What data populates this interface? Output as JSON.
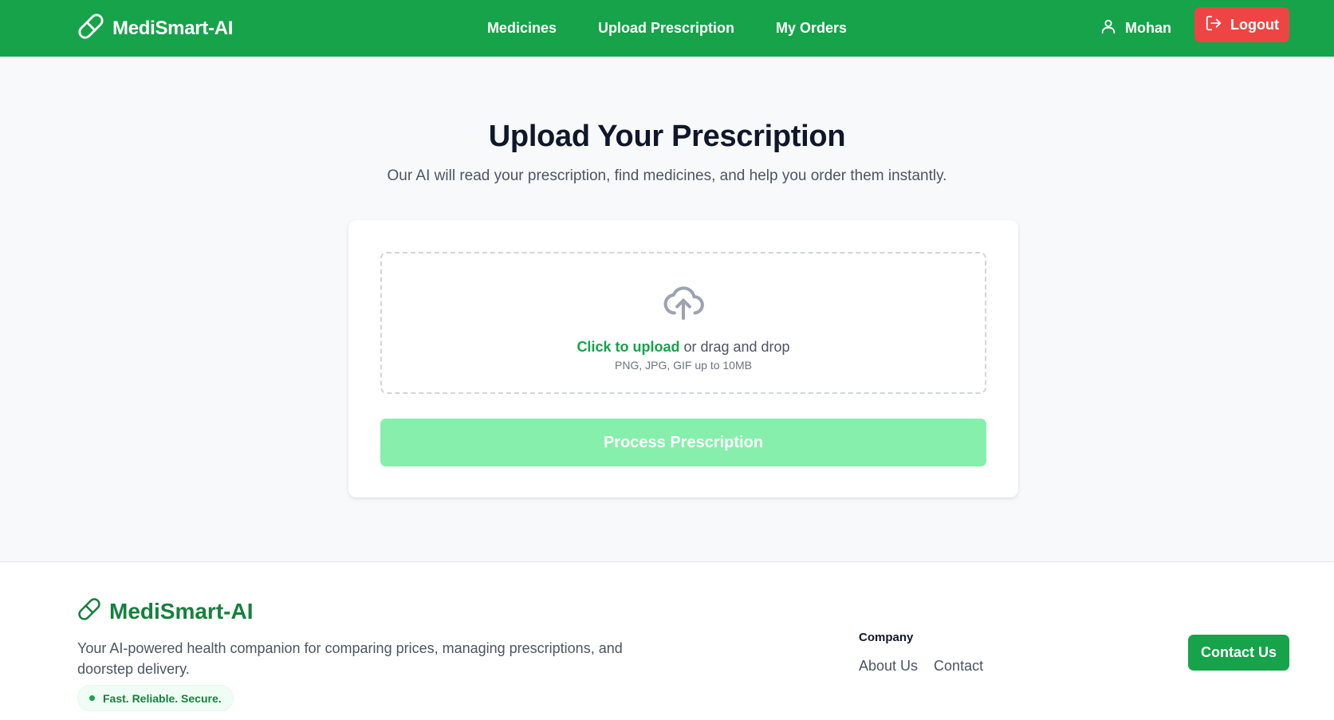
{
  "header": {
    "brand": "MediSmart-AI",
    "brand_icon": "pill-icon",
    "nav": [
      {
        "label": "Medicines"
      },
      {
        "label": "Upload Prescription"
      },
      {
        "label": "My Orders"
      }
    ],
    "user": {
      "name": "Mohan",
      "icon": "user-icon"
    },
    "logout": {
      "label": "Logout",
      "icon": "logout-icon"
    }
  },
  "main": {
    "title": "Upload Your Prescription",
    "subtitle": "Our AI will read your prescription, find medicines, and help you order them instantly.",
    "upload": {
      "icon": "upload-cloud-icon",
      "link_text": "Click to upload",
      "rest_text": " or drag and drop",
      "hint": "PNG, JPG, GIF up to 10MB"
    },
    "process_button": "Process Prescription"
  },
  "footer": {
    "brand": "MediSmart-AI",
    "description": "Your AI-powered health companion for comparing prices, managing prescriptions, and doorstep delivery.",
    "badge": "Fast. Reliable. Secure.",
    "company_heading": "Company",
    "links": [
      {
        "label": "About Us"
      },
      {
        "label": "Contact"
      }
    ],
    "contact_button": "Contact Us"
  },
  "colors": {
    "primary": "#16a34a",
    "danger": "#ef4444",
    "disabled_button": "#86efac"
  }
}
